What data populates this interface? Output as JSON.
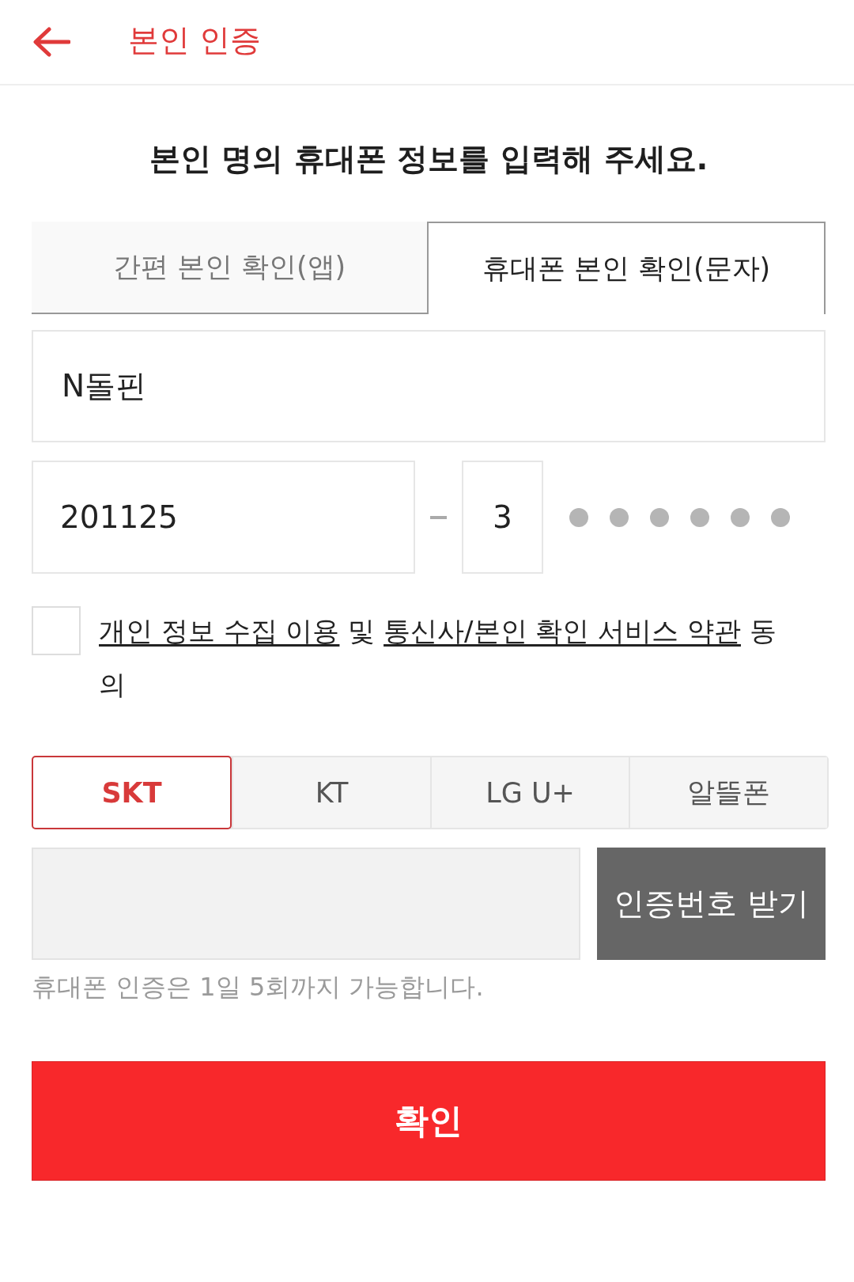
{
  "header": {
    "title": "본인 인증"
  },
  "heading": "본인 명의 휴대폰 정보를 입력해 주세요.",
  "tabs": [
    {
      "label": "간편 본인 확인(앱)",
      "selected": false
    },
    {
      "label": "휴대폰 본인 확인(문자)",
      "selected": true
    }
  ],
  "name_field": {
    "value": "N돌핀"
  },
  "birth_field": {
    "value": "201125"
  },
  "gender_field": {
    "value": "3"
  },
  "agreement": {
    "checked": false,
    "parts": [
      {
        "kind": "link",
        "text": "개인 정보 수집 이용"
      },
      {
        "kind": "plain",
        "text": " 및 "
      },
      {
        "kind": "link",
        "text": "통신사/본인 확인 서비스 약관"
      },
      {
        "kind": "plain",
        "text": " 동의"
      }
    ]
  },
  "carriers": [
    {
      "label": "SKT",
      "selected": true
    },
    {
      "label": "KT",
      "selected": false
    },
    {
      "label": "LG U+",
      "selected": false
    },
    {
      "label": "알뜰폰",
      "selected": false
    }
  ],
  "code_field": {
    "disabled": true
  },
  "request_button": {
    "label": "인증번호 받기"
  },
  "hint": "휴대폰 인증은 1일 5회까지 가능합니다.",
  "confirm_button": {
    "label": "확인"
  }
}
